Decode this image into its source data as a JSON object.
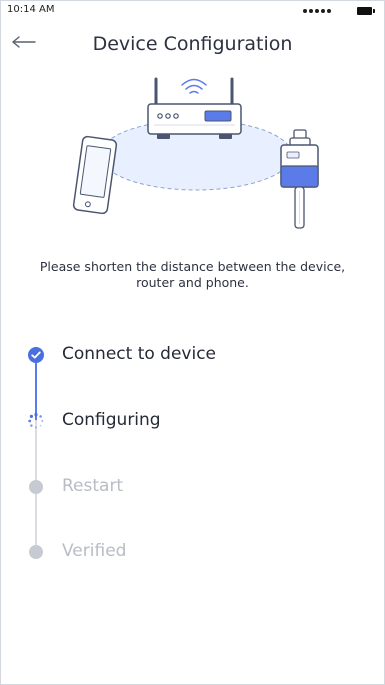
{
  "status_bar": {
    "time": "10:14 AM"
  },
  "nav": {
    "title": "Device Configuration",
    "back_icon": "arrow-left-icon"
  },
  "hint": "Please shorten the distance between the device, router and phone.",
  "steps": [
    {
      "label": "Connect to device",
      "state": "done"
    },
    {
      "label": "Configuring",
      "state": "in-progress"
    },
    {
      "label": "Restart",
      "state": "pending"
    },
    {
      "label": "Verified",
      "state": "pending"
    }
  ],
  "colors": {
    "accent": "#4A70E0",
    "title": "#2D3240",
    "pending": "#C7CAD0",
    "illustration_fill": "#E8F0FF"
  },
  "icons": {
    "router": "router-icon",
    "phone": "phone-icon",
    "device": "smart-plug-icon",
    "wifi": "wifi-icon",
    "done": "check-circle-icon",
    "loading": "loading-spinner-icon",
    "pending": "pending-dot-icon"
  }
}
